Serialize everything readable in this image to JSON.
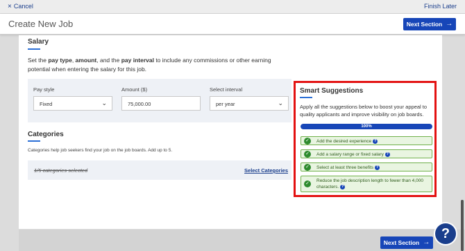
{
  "topbar": {
    "cancel_label": "Cancel",
    "finish_label": "Finish Later"
  },
  "header": {
    "title": "Create New Job",
    "next_label": "Next Section"
  },
  "salary": {
    "title": "Salary",
    "desc_1": "Set the ",
    "desc_b1": "pay type",
    "desc_2": ", ",
    "desc_b2": "amount",
    "desc_3": ", and the ",
    "desc_b3": "pay interval",
    "desc_4": " to include any commissions or other earning potential when entering the salary for this job.",
    "pay_style_label": "Pay style",
    "pay_style_value": "Fixed",
    "amount_label": "Amount ($)",
    "amount_value": "75,000.00",
    "interval_label": "Select interval",
    "interval_value": "per year"
  },
  "categories": {
    "title": "Categories",
    "desc": "Categories help job seekers find your job on the job boards. Add up to 5.",
    "selected_text": "1/5 categories selected",
    "select_link": "Select Categories"
  },
  "smart": {
    "title": "Smart Suggestions",
    "desc": "Apply all the suggestions below to boost your appeal to quality applicants and improve visibility on job boards.",
    "progress": 100,
    "progress_label": "100%",
    "suggestions": [
      "Add the desired experience",
      "Add a salary range or fixed salary",
      "Select at least three benefits",
      "Reduce the job description length to fewer than 4,000 characters."
    ]
  },
  "footer": {
    "next_label": "Next Section"
  },
  "help": {
    "label": "?"
  },
  "colors": {
    "primary": "#1746b8",
    "highlight": "#e31111",
    "success": "#2e8b2e"
  }
}
